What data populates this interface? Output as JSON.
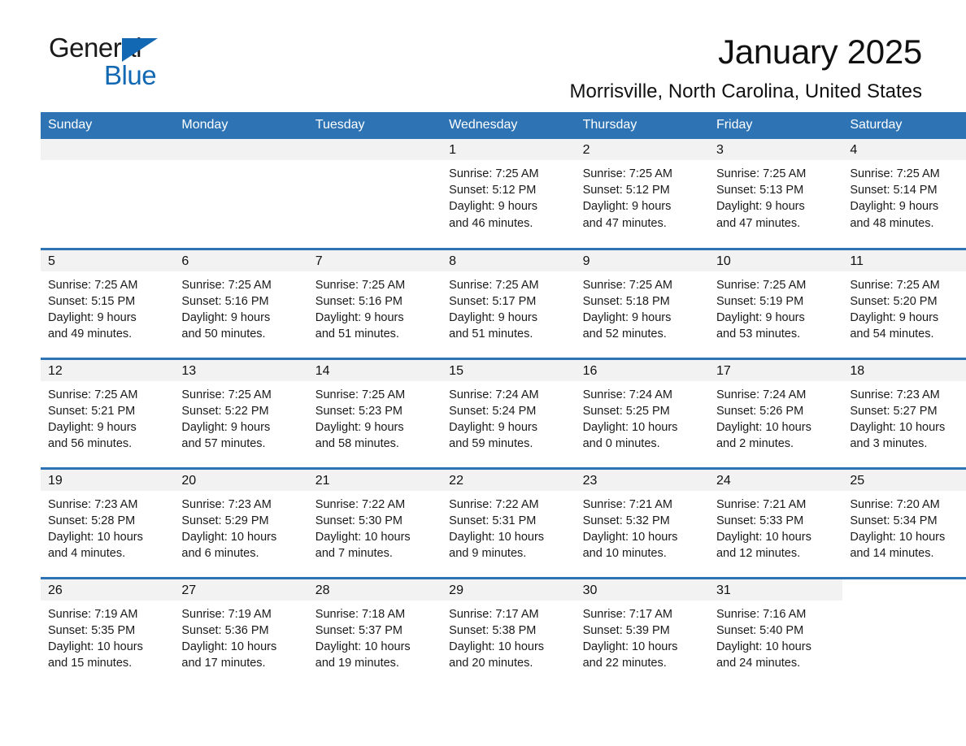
{
  "logo": {
    "word_one": "General",
    "word_two": "Blue",
    "triangle": "triangle-mark",
    "brand_color": "#1268b3"
  },
  "header": {
    "title": "January 2025",
    "location": "Morrisville, North Carolina, United States",
    "header_color": "#2e74b5"
  },
  "weekday_headers": [
    "Sunday",
    "Monday",
    "Tuesday",
    "Wednesday",
    "Thursday",
    "Friday",
    "Saturday"
  ],
  "weeks": [
    [
      {
        "day": "",
        "lines": []
      },
      {
        "day": "",
        "lines": []
      },
      {
        "day": "",
        "lines": []
      },
      {
        "day": "1",
        "lines": [
          "Sunrise: 7:25 AM",
          "Sunset: 5:12 PM",
          "Daylight: 9 hours",
          "and 46 minutes."
        ]
      },
      {
        "day": "2",
        "lines": [
          "Sunrise: 7:25 AM",
          "Sunset: 5:12 PM",
          "Daylight: 9 hours",
          "and 47 minutes."
        ]
      },
      {
        "day": "3",
        "lines": [
          "Sunrise: 7:25 AM",
          "Sunset: 5:13 PM",
          "Daylight: 9 hours",
          "and 47 minutes."
        ]
      },
      {
        "day": "4",
        "lines": [
          "Sunrise: 7:25 AM",
          "Sunset: 5:14 PM",
          "Daylight: 9 hours",
          "and 48 minutes."
        ]
      }
    ],
    [
      {
        "day": "5",
        "lines": [
          "Sunrise: 7:25 AM",
          "Sunset: 5:15 PM",
          "Daylight: 9 hours",
          "and 49 minutes."
        ]
      },
      {
        "day": "6",
        "lines": [
          "Sunrise: 7:25 AM",
          "Sunset: 5:16 PM",
          "Daylight: 9 hours",
          "and 50 minutes."
        ]
      },
      {
        "day": "7",
        "lines": [
          "Sunrise: 7:25 AM",
          "Sunset: 5:16 PM",
          "Daylight: 9 hours",
          "and 51 minutes."
        ]
      },
      {
        "day": "8",
        "lines": [
          "Sunrise: 7:25 AM",
          "Sunset: 5:17 PM",
          "Daylight: 9 hours",
          "and 51 minutes."
        ]
      },
      {
        "day": "9",
        "lines": [
          "Sunrise: 7:25 AM",
          "Sunset: 5:18 PM",
          "Daylight: 9 hours",
          "and 52 minutes."
        ]
      },
      {
        "day": "10",
        "lines": [
          "Sunrise: 7:25 AM",
          "Sunset: 5:19 PM",
          "Daylight: 9 hours",
          "and 53 minutes."
        ]
      },
      {
        "day": "11",
        "lines": [
          "Sunrise: 7:25 AM",
          "Sunset: 5:20 PM",
          "Daylight: 9 hours",
          "and 54 minutes."
        ]
      }
    ],
    [
      {
        "day": "12",
        "lines": [
          "Sunrise: 7:25 AM",
          "Sunset: 5:21 PM",
          "Daylight: 9 hours",
          "and 56 minutes."
        ]
      },
      {
        "day": "13",
        "lines": [
          "Sunrise: 7:25 AM",
          "Sunset: 5:22 PM",
          "Daylight: 9 hours",
          "and 57 minutes."
        ]
      },
      {
        "day": "14",
        "lines": [
          "Sunrise: 7:25 AM",
          "Sunset: 5:23 PM",
          "Daylight: 9 hours",
          "and 58 minutes."
        ]
      },
      {
        "day": "15",
        "lines": [
          "Sunrise: 7:24 AM",
          "Sunset: 5:24 PM",
          "Daylight: 9 hours",
          "and 59 minutes."
        ]
      },
      {
        "day": "16",
        "lines": [
          "Sunrise: 7:24 AM",
          "Sunset: 5:25 PM",
          "Daylight: 10 hours",
          "and 0 minutes."
        ]
      },
      {
        "day": "17",
        "lines": [
          "Sunrise: 7:24 AM",
          "Sunset: 5:26 PM",
          "Daylight: 10 hours",
          "and 2 minutes."
        ]
      },
      {
        "day": "18",
        "lines": [
          "Sunrise: 7:23 AM",
          "Sunset: 5:27 PM",
          "Daylight: 10 hours",
          "and 3 minutes."
        ]
      }
    ],
    [
      {
        "day": "19",
        "lines": [
          "Sunrise: 7:23 AM",
          "Sunset: 5:28 PM",
          "Daylight: 10 hours",
          "and 4 minutes."
        ]
      },
      {
        "day": "20",
        "lines": [
          "Sunrise: 7:23 AM",
          "Sunset: 5:29 PM",
          "Daylight: 10 hours",
          "and 6 minutes."
        ]
      },
      {
        "day": "21",
        "lines": [
          "Sunrise: 7:22 AM",
          "Sunset: 5:30 PM",
          "Daylight: 10 hours",
          "and 7 minutes."
        ]
      },
      {
        "day": "22",
        "lines": [
          "Sunrise: 7:22 AM",
          "Sunset: 5:31 PM",
          "Daylight: 10 hours",
          "and 9 minutes."
        ]
      },
      {
        "day": "23",
        "lines": [
          "Sunrise: 7:21 AM",
          "Sunset: 5:32 PM",
          "Daylight: 10 hours",
          "and 10 minutes."
        ]
      },
      {
        "day": "24",
        "lines": [
          "Sunrise: 7:21 AM",
          "Sunset: 5:33 PM",
          "Daylight: 10 hours",
          "and 12 minutes."
        ]
      },
      {
        "day": "25",
        "lines": [
          "Sunrise: 7:20 AM",
          "Sunset: 5:34 PM",
          "Daylight: 10 hours",
          "and 14 minutes."
        ]
      }
    ],
    [
      {
        "day": "26",
        "lines": [
          "Sunrise: 7:19 AM",
          "Sunset: 5:35 PM",
          "Daylight: 10 hours",
          "and 15 minutes."
        ]
      },
      {
        "day": "27",
        "lines": [
          "Sunrise: 7:19 AM",
          "Sunset: 5:36 PM",
          "Daylight: 10 hours",
          "and 17 minutes."
        ]
      },
      {
        "day": "28",
        "lines": [
          "Sunrise: 7:18 AM",
          "Sunset: 5:37 PM",
          "Daylight: 10 hours",
          "and 19 minutes."
        ]
      },
      {
        "day": "29",
        "lines": [
          "Sunrise: 7:17 AM",
          "Sunset: 5:38 PM",
          "Daylight: 10 hours",
          "and 20 minutes."
        ]
      },
      {
        "day": "30",
        "lines": [
          "Sunrise: 7:17 AM",
          "Sunset: 5:39 PM",
          "Daylight: 10 hours",
          "and 22 minutes."
        ]
      },
      {
        "day": "31",
        "lines": [
          "Sunrise: 7:16 AM",
          "Sunset: 5:40 PM",
          "Daylight: 10 hours",
          "and 24 minutes."
        ]
      },
      {
        "day": "",
        "lines": []
      }
    ]
  ]
}
